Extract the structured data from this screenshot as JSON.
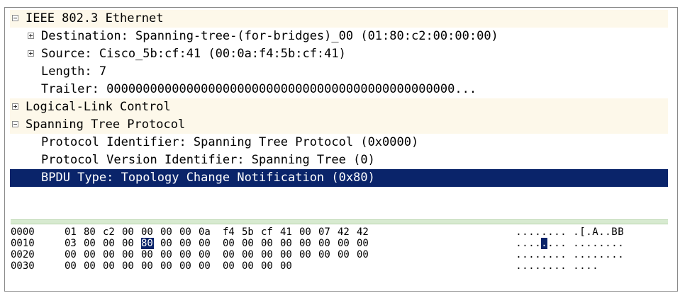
{
  "details": [
    {
      "level": 0,
      "expander": "minus",
      "text": "IEEE 802.3 Ethernet",
      "style": "hdr"
    },
    {
      "level": 1,
      "expander": "plus",
      "text": "Destination: Spanning-tree-(for-bridges)_00 (01:80:c2:00:00:00)",
      "style": ""
    },
    {
      "level": 1,
      "expander": "plus",
      "text": "Source: Cisco_5b:cf:41 (00:0a:f4:5b:cf:41)",
      "style": ""
    },
    {
      "level": 2,
      "expander": "",
      "text": "Length: 7",
      "style": ""
    },
    {
      "level": 2,
      "expander": "",
      "text": "Trailer: 000000000000000000000000000000000000000000000000...",
      "style": ""
    },
    {
      "level": 0,
      "expander": "plus",
      "text": "Logical-Link Control",
      "style": "hdr"
    },
    {
      "level": 0,
      "expander": "minus",
      "text": "Spanning Tree Protocol",
      "style": "hdr"
    },
    {
      "level": 2,
      "expander": "",
      "text": "Protocol Identifier: Spanning Tree Protocol (0x0000)",
      "style": ""
    },
    {
      "level": 2,
      "expander": "",
      "text": "Protocol Version Identifier: Spanning Tree (0)",
      "style": ""
    },
    {
      "level": 2,
      "expander": "",
      "text": "BPDU Type: Topology Change Notification (0x80)",
      "style": "sel"
    }
  ],
  "hexdump": [
    {
      "offset": "0000",
      "bytes": [
        "01",
        "80",
        "c2",
        "00",
        "00",
        "00",
        "00",
        "0a",
        "f4",
        "5b",
        "cf",
        "41",
        "00",
        "07",
        "42",
        "42"
      ],
      "ascii": "........ .[.A..BB"
    },
    {
      "offset": "0010",
      "bytes": [
        "03",
        "00",
        "00",
        "00",
        "80",
        "00",
        "00",
        "00",
        "00",
        "00",
        "00",
        "00",
        "00",
        "00",
        "00",
        "00"
      ],
      "ascii": "........ ........"
    },
    {
      "offset": "0020",
      "bytes": [
        "00",
        "00",
        "00",
        "00",
        "00",
        "00",
        "00",
        "00",
        "00",
        "00",
        "00",
        "00",
        "00",
        "00",
        "00",
        "00"
      ],
      "ascii": "........ ........"
    },
    {
      "offset": "0030",
      "bytes": [
        "00",
        "00",
        "00",
        "00",
        "00",
        "00",
        "00",
        "00",
        "00",
        "00",
        "00",
        "00"
      ],
      "ascii": "........ ...."
    }
  ],
  "highlight": {
    "row": 1,
    "byte_index": 4
  },
  "colors": {
    "selection": "#0a246a",
    "header_bg": "#fdf8ea",
    "splitter": "#d7ead0"
  }
}
